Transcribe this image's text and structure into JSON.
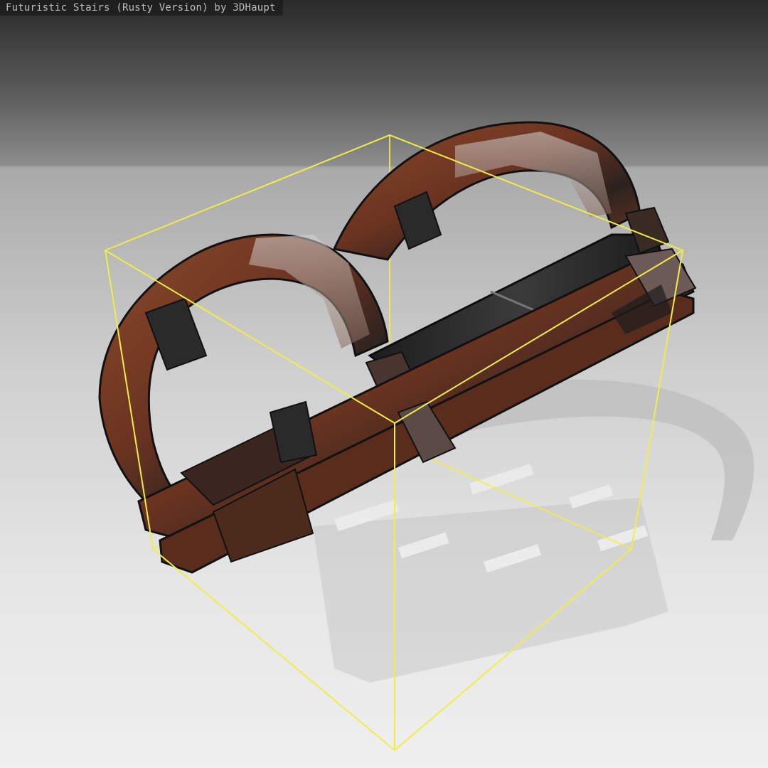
{
  "viewer": {
    "title": "Futuristic Stairs (Rusty Version) by 3DHaupt",
    "bounding_box_color": "#f2ec48",
    "model_colors": {
      "rust": "#7a3b22",
      "rust_dark": "#4a2416",
      "metal_dark": "#232323",
      "metal_light": "#9a9a9a"
    }
  }
}
